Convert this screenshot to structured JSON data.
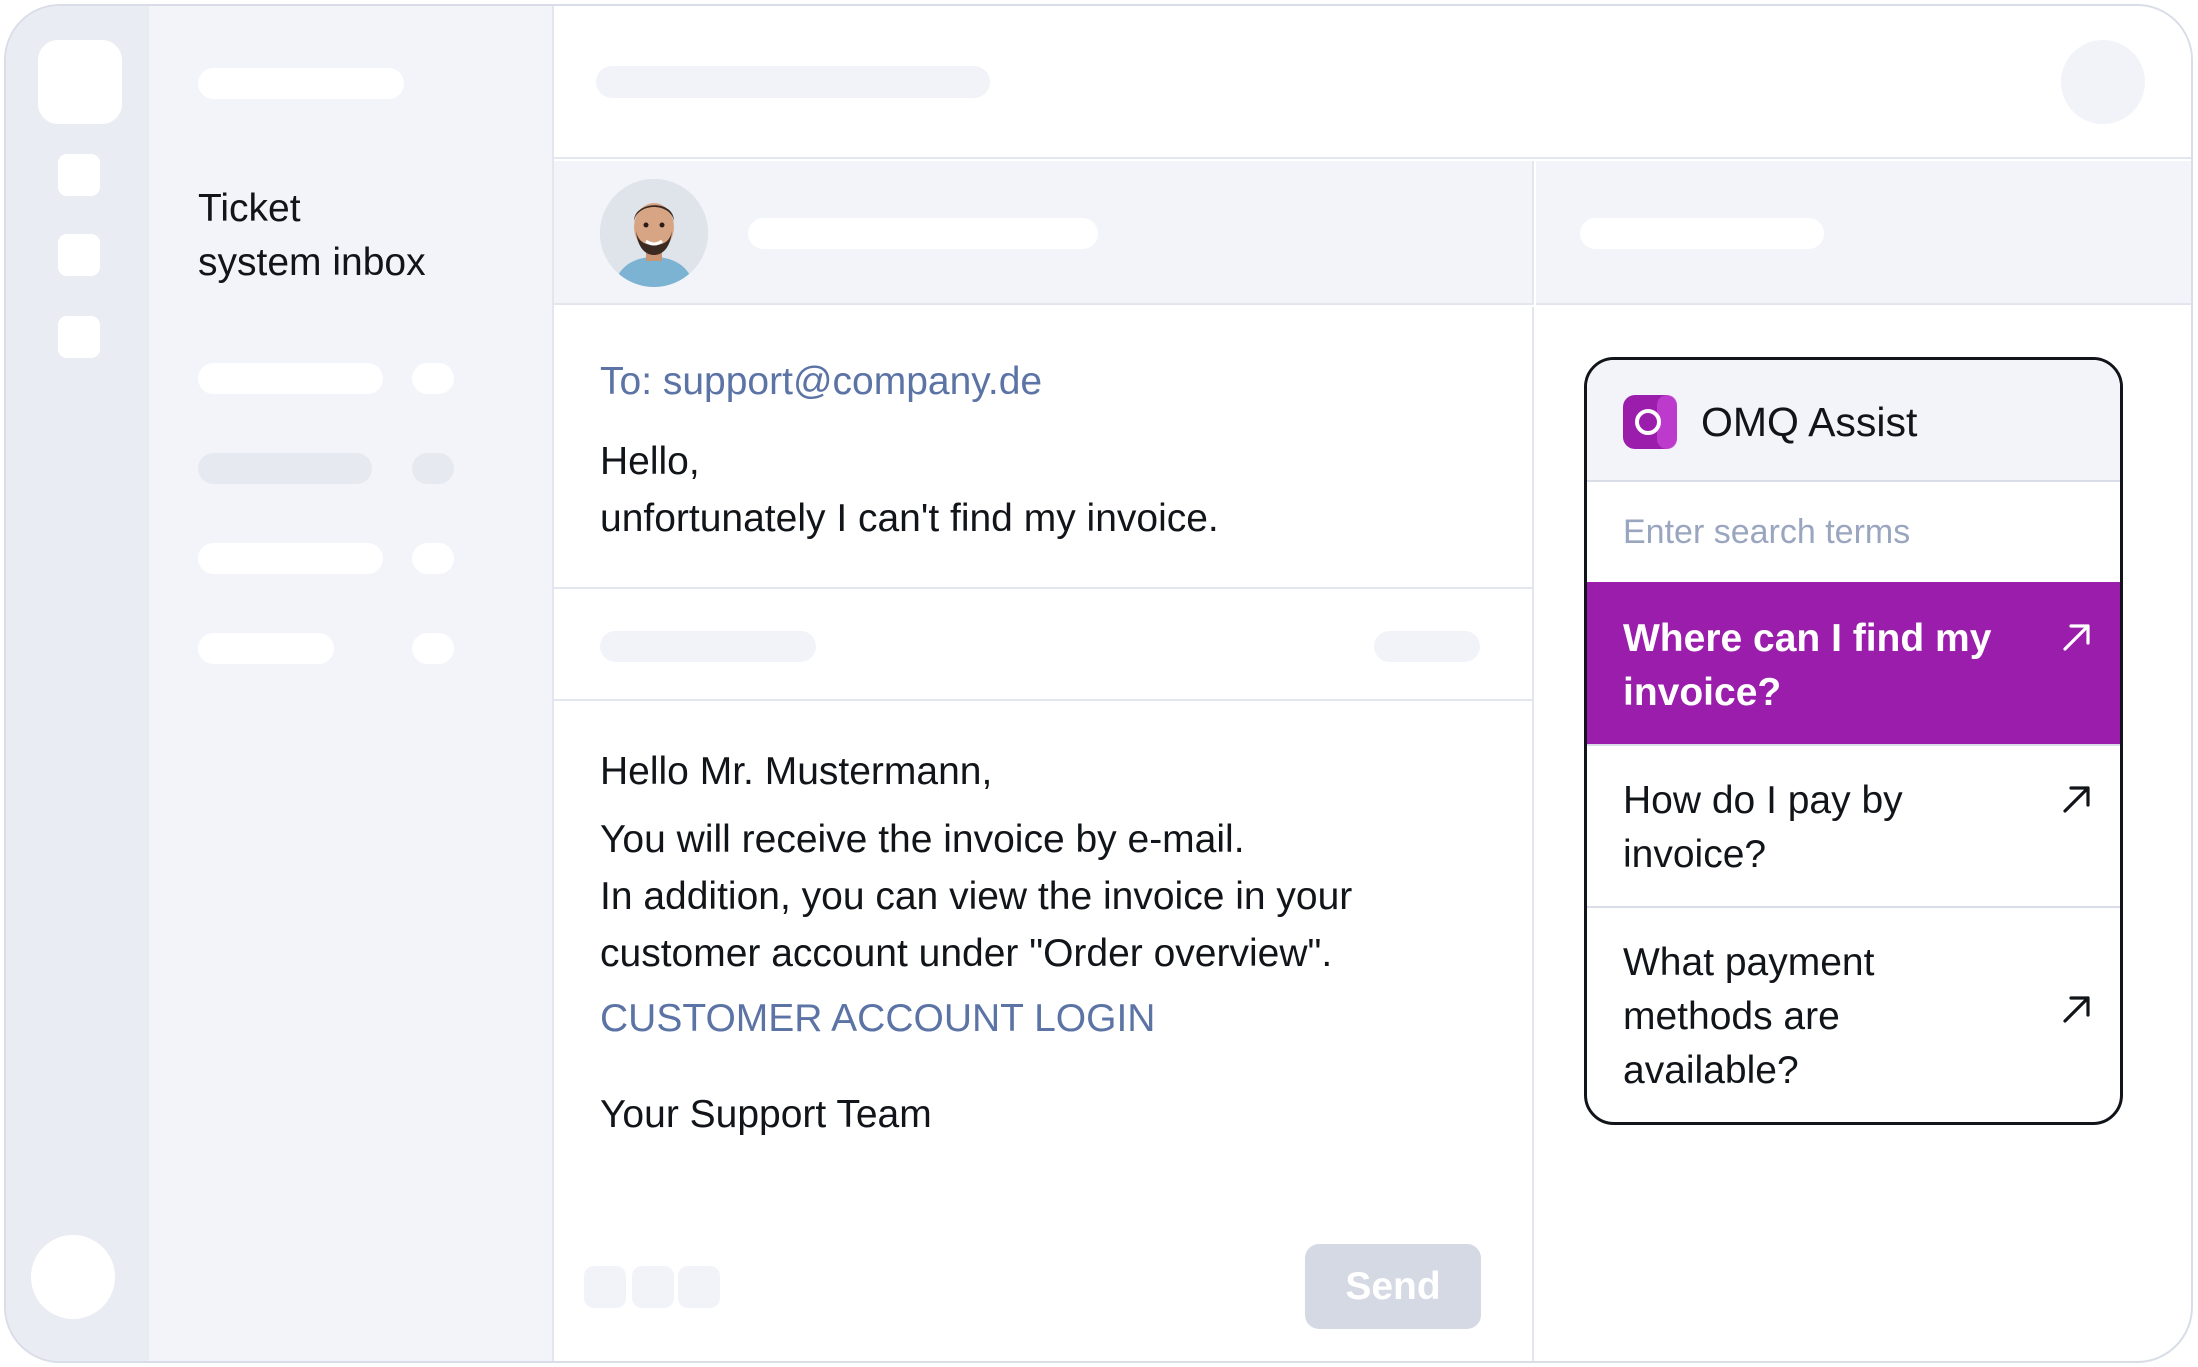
{
  "nav": {
    "title_line1": "Ticket",
    "title_line2": "system inbox"
  },
  "email": {
    "to": "To: support@company.de",
    "greeting": "Hello,",
    "body": "unfortunately I can't find my invoice."
  },
  "reply": {
    "greeting": "Hello Mr. Mustermann,",
    "line1": "You will receive the invoice by e-mail.",
    "line2": "In addition, you can view the invoice in your",
    "line3": "customer account under \"Order overview\".",
    "link": "CUSTOMER ACCOUNT LOGIN",
    "signature": "Your Support Team",
    "send_label": "Send"
  },
  "assist": {
    "title": "OMQ Assist",
    "search_placeholder": "Enter search terms",
    "items": [
      {
        "label_line1": "Where can I find my",
        "label_line2": "invoice?",
        "active": true
      },
      {
        "label_line1": "How do I pay by",
        "label_line2": "invoice?",
        "active": false
      },
      {
        "label_line1": "What payment",
        "label_line2": "methods are",
        "label_line3": "available?",
        "active": false
      }
    ]
  },
  "colors": {
    "accent": "#9b1dab",
    "link": "#5c73a5",
    "panel": "#f3f4f9",
    "rail": "#e9ecf3",
    "send_disabled": "#d4d9e4"
  },
  "icons": {
    "assist_logo": "omq-logo-icon",
    "item_arrow": "arrow-up-right-icon"
  }
}
